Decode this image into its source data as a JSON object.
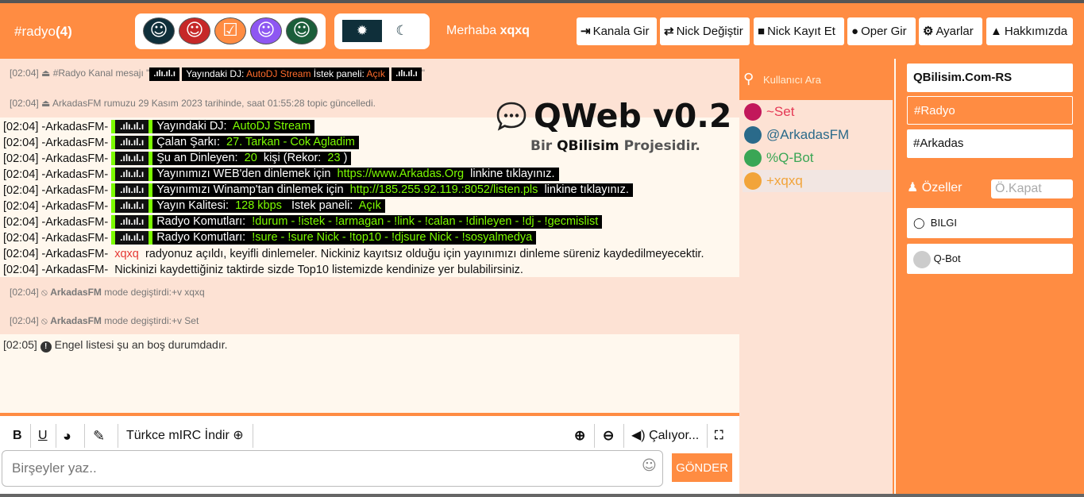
{
  "header": {
    "channel_name": "#radyo",
    "channel_count": "(4)",
    "greeting_prefix": "Merhaba",
    "username": "xqxq",
    "buttons": [
      {
        "icon": "sign-in-icon",
        "glyph": "⇥",
        "label": "Kanala Gir"
      },
      {
        "icon": "exchange-icon",
        "glyph": "⇄",
        "label": "Nick Değiştir"
      },
      {
        "icon": "save-icon",
        "glyph": "■",
        "label": "Nick Kayıt Et"
      },
      {
        "icon": "oper-icon",
        "glyph": "●",
        "label": "Oper Gir"
      },
      {
        "icon": "gears-icon",
        "glyph": "⚙",
        "label": "Ayarlar"
      },
      {
        "icon": "warning-icon",
        "glyph": "▲",
        "label": "Hakkımızda"
      }
    ]
  },
  "themes": {
    "colors": [
      "#0f2f3a",
      "#c62828",
      "#ff8c42",
      "#8e57f2",
      "#1b5e3a"
    ],
    "sun_glyph": "✹",
    "moon_glyph": "☾"
  },
  "system_messages": {
    "kanal_time": "[02:04]",
    "kanal_prefix": "⏏ #Radyo Kanal mesajı \"",
    "kanal_bar1": ".ılı.ıl.ı",
    "kanal_dj": "Yayındaki DJ:",
    "kanal_dj_val": "AutoDJ Stream",
    "kanal_panel": "İstek paneli:",
    "kanal_panel_val": "Açık",
    "kanal_bar2": ".ılı.ıl.ı",
    "kanal_suffix": "\"",
    "topic": "[02:04] ⏏ ArkadasFM rumuzu 29 Kasım 2023 tarihinde, saat 01:55:28 topic güncelledi.",
    "mode1_time": "[02:04]",
    "mode1_user": "ArkadasFM",
    "mode1_text": "mode degiştirdi:+v xqxq",
    "mode2_time": "[02:04]",
    "mode2_user": "ArkadasFM",
    "mode2_text": "mode degiştirdi:+v Set",
    "ban_time": "[02:05]",
    "ban_text": "Engel listesi şu an boş durumdadır."
  },
  "chat_lines": [
    {
      "prefix": "[02:04] -ArkadasFM-",
      "bar": ".ılı.ıl.ı",
      "a": "Yayındaki DJ:",
      "b": "AutoDJ Stream"
    },
    {
      "prefix": "[02:04] -ArkadasFM-",
      "bar": ".ılı.ıl.ı",
      "a": "Çalan Şarkı:",
      "b": "27. Tarkan - Cok Agladim"
    },
    {
      "prefix": "[02:04] -ArkadasFM-",
      "bar": ".ılı.ıl.ı",
      "a": "Şu an Dinleyen:",
      "b": "20",
      "c": "kişi (Rekor:",
      "d": "23",
      "e": ")"
    },
    {
      "prefix": "[02:04] -ArkadasFM-",
      "bar": ".ılı.ıl.ı",
      "a": "Yayınımızı WEB'den dinlemek için",
      "b": "https://www.Arkadas.Org",
      "c": "linkine tıklayınız."
    },
    {
      "prefix": "[02:04] -ArkadasFM-",
      "bar": ".ılı.ıl.ı",
      "a": "Yayınımızı Winamp'tan dinlemek için",
      "b": "http://185.255.92.119.:8052/listen.pls",
      "c": "linkine tıklayınız."
    },
    {
      "prefix": "[02:04] -ArkadasFM-",
      "bar": ".ılı.ıl.ı",
      "a": "Yayın Kalitesi:",
      "b": "128 kbps",
      "c": "İstek paneli:",
      "d": "Açık"
    },
    {
      "prefix": "[02:04] -ArkadasFM-",
      "bar": ".ılı.ıl.ı",
      "a": "Radyo Komutları:",
      "b": "!durum - !istek - !armagan - !link - !calan - !dinleyen - !dj - !gecmislist"
    },
    {
      "prefix": "[02:04] -ArkadasFM-",
      "bar": ".ılı.ıl.ı",
      "a": "Radyo Komutları:",
      "b": "!sure - !sure Nick - !top10 - !djsure Nick - !sosyalmedya"
    }
  ],
  "plain_lines": [
    {
      "prefix": "[02:04] -ArkadasFM-",
      "nick": "xqxq",
      "text": "radyonuz açıldı, keyifli dinlemeler. Nickiniz kayıtsız olduğu için yayınımızı dinleme süreniz kaydedilmeyecektir."
    },
    {
      "prefix": "[02:04] -ArkadasFM-",
      "nick": "",
      "text": "Nickinizi kaydettiğiniz taktirde sizde Top10 listemizde kendinize yer bulabilirsiniz."
    }
  ],
  "logo": {
    "title": "QWeb v0.2",
    "sub_prefix": "Bir",
    "sub_brand": "QBilisim",
    "sub_suffix": "Projesidir."
  },
  "composer": {
    "bold": "B",
    "underline": "U",
    "mirc_link": "Türkce mIRC İndir",
    "playing": "Çalıyor...",
    "placeholder": "Birşeyler yaz..",
    "send": "GÖNDER"
  },
  "users": {
    "search_placeholder": "Kullanıcı Ara",
    "list": [
      {
        "name": "~Set",
        "color": "#e53955",
        "avatar": "#c2185b"
      },
      {
        "name": "@ArkadasFM",
        "color": "#2a6a8a",
        "avatar": "#2a6a8a"
      },
      {
        "name": "%Q-Bot",
        "color": "#3aa655",
        "avatar": "#3aa655"
      },
      {
        "name": "+xqxq",
        "color": "#f2a43a",
        "avatar": "#f2a43a"
      }
    ]
  },
  "channels": {
    "server": "QBilisim.Com-RS",
    "list": [
      "#Radyo",
      "#Arkadas"
    ],
    "private_head": "Özeller",
    "private_close": "Ö.Kapat",
    "privates": [
      "BILGI",
      "Q-Bot"
    ]
  }
}
